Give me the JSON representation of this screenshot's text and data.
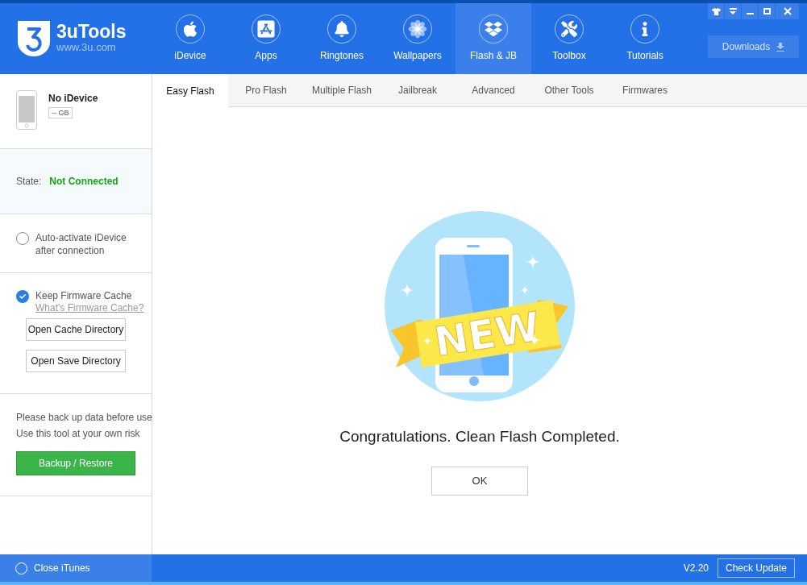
{
  "app": {
    "name": "3uTools",
    "url": "www.3u.com"
  },
  "nav": [
    {
      "label": "iDevice",
      "selected": false
    },
    {
      "label": "Apps",
      "selected": false
    },
    {
      "label": "Ringtones",
      "selected": false
    },
    {
      "label": "Wallpapers",
      "selected": false
    },
    {
      "label": "Flash & JB",
      "selected": true
    },
    {
      "label": "Toolbox",
      "selected": false
    },
    {
      "label": "Tutorials",
      "selected": false
    }
  ],
  "downloads": "Downloads",
  "device": {
    "name": "No iDevice",
    "capacity": "-- GB"
  },
  "state": {
    "label": "State:",
    "value": "Not Connected"
  },
  "auto_activate": {
    "label": "Auto-activate iDevice after connection",
    "checked": false
  },
  "firmware_cache": {
    "label": "Keep Firmware Cache",
    "checked": true,
    "link": "What's Firmware Cache?"
  },
  "directory_buttons": [
    "Open Cache Directory",
    "Open Save Directory"
  ],
  "warnings": [
    "Please back up data before use",
    "Use this tool at your own risk"
  ],
  "backup_button": "Backup / Restore",
  "tabs": [
    {
      "label": "Easy Flash",
      "selected": true
    },
    {
      "label": "Pro Flash",
      "selected": false
    },
    {
      "label": "Multiple Flash",
      "selected": false
    },
    {
      "label": "Jailbreak",
      "selected": false
    },
    {
      "label": "Advanced",
      "selected": false
    },
    {
      "label": "Other Tools",
      "selected": false
    },
    {
      "label": "Firmwares",
      "selected": false
    }
  ],
  "illustration": {
    "banner": "NEW"
  },
  "message": "Congratulations. Clean Flash Completed.",
  "ok_button": "OK",
  "status_bar": {
    "close_itunes": {
      "label": "Close iTunes",
      "checked": false
    },
    "version": "V2.20",
    "check_update": "Check Update"
  }
}
